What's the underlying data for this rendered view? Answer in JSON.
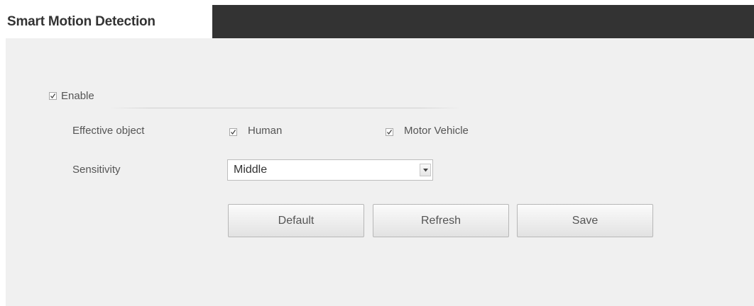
{
  "panel": {
    "title": "Smart Motion Detection"
  },
  "enable": {
    "label": "Enable",
    "checked": true
  },
  "effective_object": {
    "label": "Effective object",
    "options": [
      {
        "label": "Human",
        "checked": true
      },
      {
        "label": "Motor Vehicle",
        "checked": true
      }
    ]
  },
  "sensitivity": {
    "label": "Sensitivity",
    "selected": "Middle"
  },
  "buttons": {
    "default": "Default",
    "refresh": "Refresh",
    "save": "Save"
  },
  "icons": {
    "checkbox": "check-icon",
    "dropdown": "triangle-down-icon"
  }
}
